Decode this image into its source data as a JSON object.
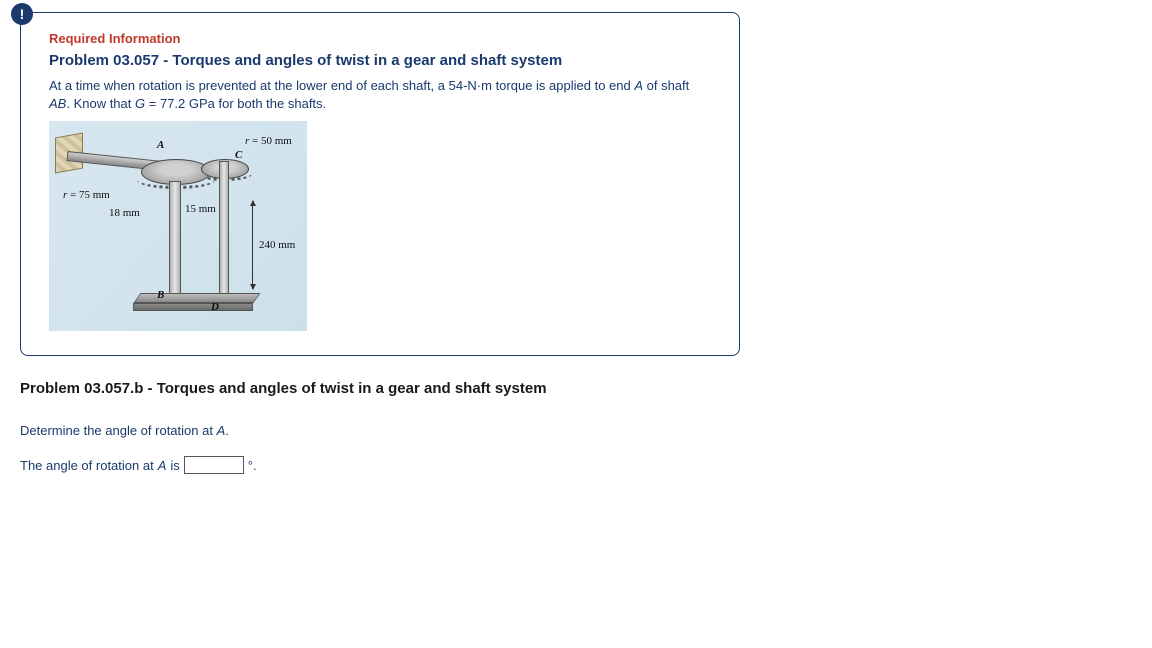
{
  "badge": "!",
  "required_label": "Required Information",
  "title": "Problem 03.057 - Torques and angles of twist in a gear and shaft system",
  "description_1": "At a time when rotation is prevented at the lower end of each shaft, a 54-N·m torque is applied to end ",
  "description_ital_A": "A",
  "description_2": " of shaft ",
  "description_ital_AB": "AB",
  "description_3": ". Know that ",
  "description_ital_G": "G",
  "description_4": " = 77.2 GPa for both the shafts.",
  "diagram": {
    "ptA": "A",
    "ptB": "B",
    "ptC": "C",
    "ptD": "D",
    "r50_prefix": "r",
    "r50": " = 50 mm",
    "r75_prefix": "r",
    "r75": " = 75 mm",
    "d18": "18 mm",
    "d15": "15 mm",
    "d240": "240 mm"
  },
  "sub_title": "Problem 03.057.b - Torques and angles of twist in a gear and shaft system",
  "question": "Determine the angle of rotation at ",
  "question_ital": "A",
  "question_end": ".",
  "answer_lead": "The angle of rotation at ",
  "answer_ital": "A",
  "answer_mid": " is ",
  "answer_unit": "°.",
  "answer_value": ""
}
